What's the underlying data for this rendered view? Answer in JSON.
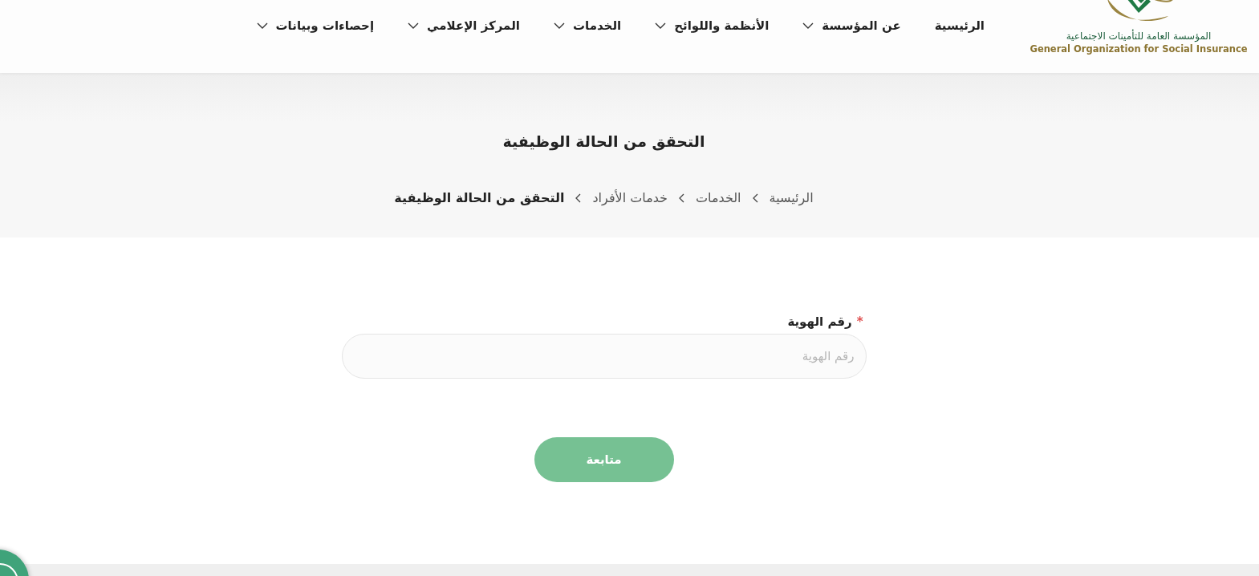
{
  "logo": {
    "arabic": "المؤسسة العامة للتأمينات الاجتماعية",
    "english": "General Organization for Social Insurance"
  },
  "nav": [
    {
      "label": "الرئيسية",
      "has_dropdown": false
    },
    {
      "label": "عن المؤسسة",
      "has_dropdown": true
    },
    {
      "label": "الأنظمة واللوائح",
      "has_dropdown": true
    },
    {
      "label": "الخدمات",
      "has_dropdown": true
    },
    {
      "label": "المركز الإعلامي",
      "has_dropdown": true
    },
    {
      "label": "إحصاءات وبيانات",
      "has_dropdown": true
    }
  ],
  "page_title": "التحقق من الحالة الوظيفية",
  "breadcrumb": [
    {
      "label": "الرئيسية",
      "current": false
    },
    {
      "label": "الخدمات",
      "current": false
    },
    {
      "label": "خدمات الأفراد",
      "current": false
    },
    {
      "label": "التحقق من الحالة الوظيفية",
      "current": true
    }
  ],
  "form": {
    "field": {
      "required_mark": "*",
      "label": "رقم الهوية",
      "placeholder": "رقم الهوية"
    },
    "submit": {
      "label": "متابعة",
      "disabled": true
    }
  }
}
